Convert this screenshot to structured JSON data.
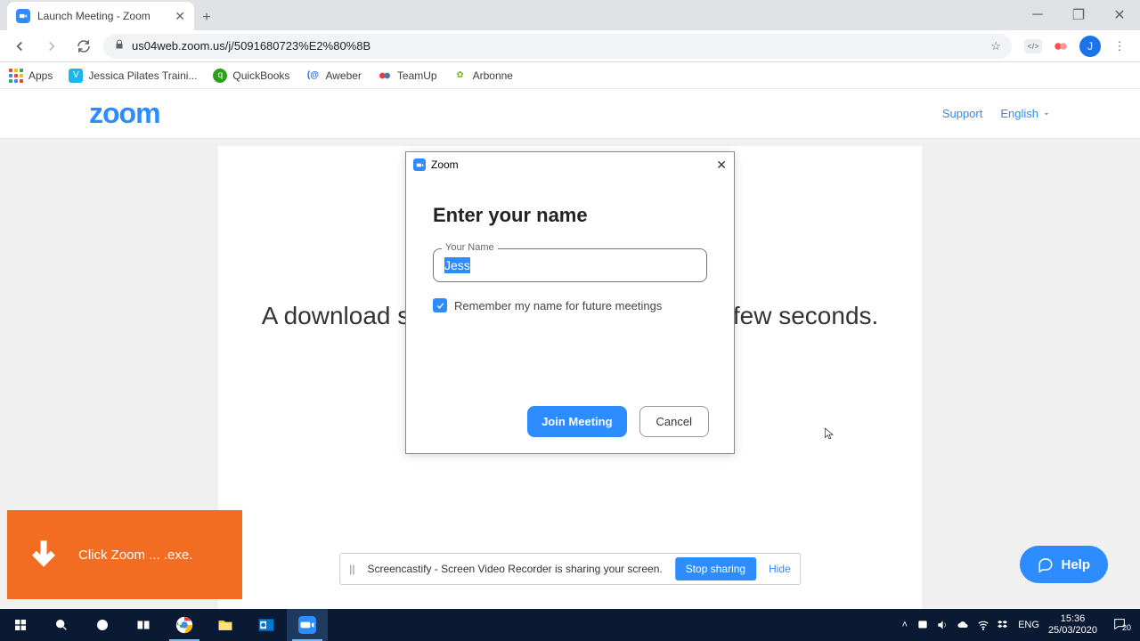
{
  "chrome": {
    "tab_title": "Launch Meeting - Zoom",
    "url": "us04web.zoom.us/j/5091680723%E2%80%8B",
    "avatar_letter": "J"
  },
  "bookmarks": {
    "apps": "Apps",
    "items": [
      "Jessica Pilates Traini...",
      "QuickBooks",
      "Aweber",
      "TeamUp",
      "Arbonne"
    ]
  },
  "header": {
    "logo": "zoom",
    "support": "Support",
    "language": "English"
  },
  "page": {
    "download_text": "A download should start automatically in a few seconds."
  },
  "dialog": {
    "title": "Zoom",
    "heading": "Enter your name",
    "field_label": "Your Name",
    "name_value": "Jess",
    "remember_label": "Remember my name for future meetings",
    "remember_checked": true,
    "join_label": "Join Meeting",
    "cancel_label": "Cancel"
  },
  "download_banner": {
    "text": "Click Zoom ... .exe."
  },
  "share_bar": {
    "message": "Screencastify - Screen Video Recorder is sharing your screen.",
    "stop": "Stop sharing",
    "hide": "Hide"
  },
  "help_button": "Help",
  "taskbar": {
    "lang": "ENG",
    "time": "15:36",
    "date": "25/03/2020",
    "notif_count": "20"
  }
}
